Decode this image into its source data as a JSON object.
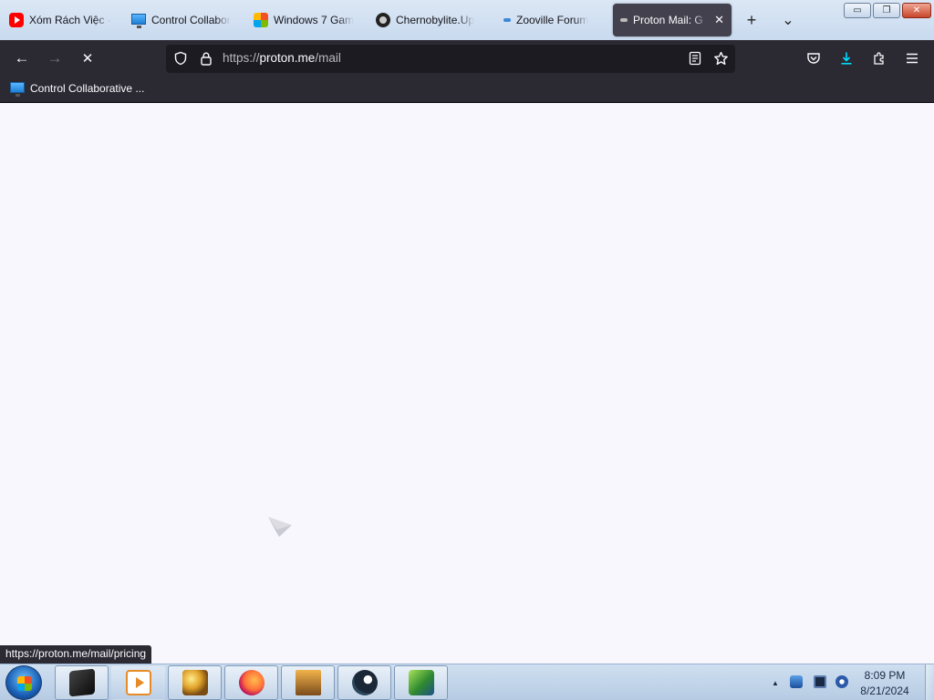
{
  "tabs": [
    {
      "label": "Xóm Rách Việc -",
      "icon": "youtube-icon"
    },
    {
      "label": "Control Collabor",
      "icon": "monitor-icon"
    },
    {
      "label": "Windows 7 Gam",
      "icon": "windows-icon"
    },
    {
      "label": "Chernobylite.Up",
      "icon": "chernobylite-icon"
    },
    {
      "label": "Zooville Forum",
      "icon": "loading-dot-icon"
    },
    {
      "label": "Proton Mail: G",
      "icon": "loading-dot-icon",
      "active": true
    }
  ],
  "tab_controls": {
    "new_tab": "+",
    "list_tabs": "⌄",
    "close_tab": "✕"
  },
  "window_controls": {
    "minimize": "▭",
    "restore": "❐",
    "close": "✕"
  },
  "nav": {
    "back": "←",
    "forward": "→",
    "stop": "✕"
  },
  "urlbar": {
    "scheme": "https://",
    "host": "proton.me",
    "path": "/mail"
  },
  "bookmarks": [
    {
      "label": "Control Collaborative ...",
      "icon": "monitor-icon"
    }
  ],
  "status_link": "https://proton.me/mail/pricing",
  "taskbar": {
    "pinned": [
      "black-cube-app-icon",
      "media-player-icon",
      "paint-icon",
      "firefox-icon",
      "counter-strike-icon",
      "steam-icon",
      "green-arrow-app-icon"
    ],
    "clock_time": "8:09 PM",
    "clock_date": "8/21/2024",
    "tray_arrow": "▲"
  },
  "colors": {
    "toolbar_bg": "#2b2a33",
    "urlbar_bg": "#1c1b22",
    "active_tab_bg": "#42414d",
    "content_bg": "#f7f7fd",
    "download_accent": "#00ddff"
  }
}
